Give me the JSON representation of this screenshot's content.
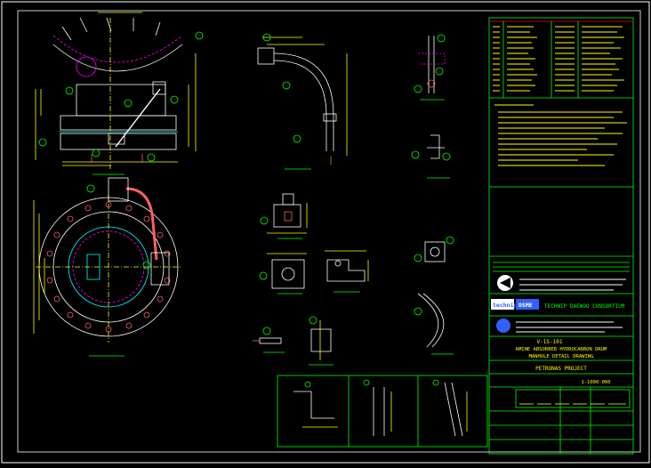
{
  "colors": {
    "background": "#000000",
    "border": "#ffffff",
    "geometry": "#ffffff",
    "dimension": "#ffff00",
    "block": "#00ff00",
    "callout": "#00ff00",
    "hidden": "#ff00ff",
    "pipe": "#ff6060",
    "title_block": "#00ff00",
    "text_yellow": "#ffff00",
    "header_red": "#ff0000"
  },
  "title_block": {
    "company_name": "TECHNIP DAEWOO CONSORTIUM",
    "logo_left": "technip",
    "logo_right": "DSME",
    "drawing_line1": "V-1S-101",
    "drawing_line2": "AMINE ABSORBER HYDROCARBON DRUM",
    "drawing_line3": "MANHOLE DETAIL DRAWING",
    "project": "PETRONAS PROJECT",
    "job_no": "1-1000-000"
  }
}
